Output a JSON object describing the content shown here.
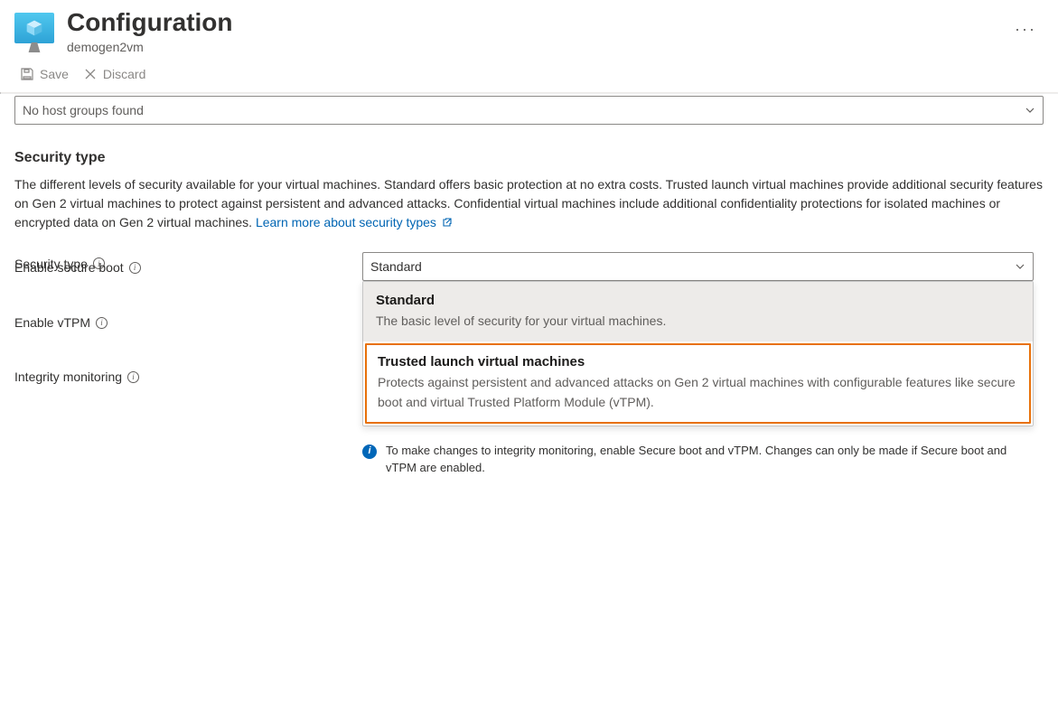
{
  "header": {
    "title": "Configuration",
    "subtitle": "demogen2vm"
  },
  "toolbar": {
    "save": "Save",
    "discard": "Discard"
  },
  "host_group": {
    "value": "No host groups found"
  },
  "security_section": {
    "heading": "Security type",
    "description": "The different levels of security available for your virtual machines. Standard offers basic protection at no extra costs. Trusted launch virtual machines provide additional security features on Gen 2 virtual machines to protect against persistent and advanced attacks. Confidential virtual machines include additional confidentiality protections for isolated machines or encrypted data on Gen 2 virtual machines.",
    "learn_more": "Learn more about security types",
    "fields": {
      "security_type_label": "Security type",
      "secure_boot_label": "Enable secure boot",
      "vtpm_label": "Enable vTPM",
      "integrity_label": "Integrity monitoring"
    },
    "security_type_value": "Standard",
    "options": {
      "standard": {
        "title": "Standard",
        "desc": "The basic level of security for your virtual machines."
      },
      "trusted": {
        "title": "Trusted launch virtual machines",
        "desc": "Protects against persistent and advanced attacks on Gen 2 virtual machines with configurable features like secure boot and virtual Trusted Platform Module (vTPM)."
      }
    },
    "integrity_hint": "To make changes to integrity monitoring, enable Secure boot and vTPM. Changes can only be made if Secure boot and vTPM are enabled."
  }
}
